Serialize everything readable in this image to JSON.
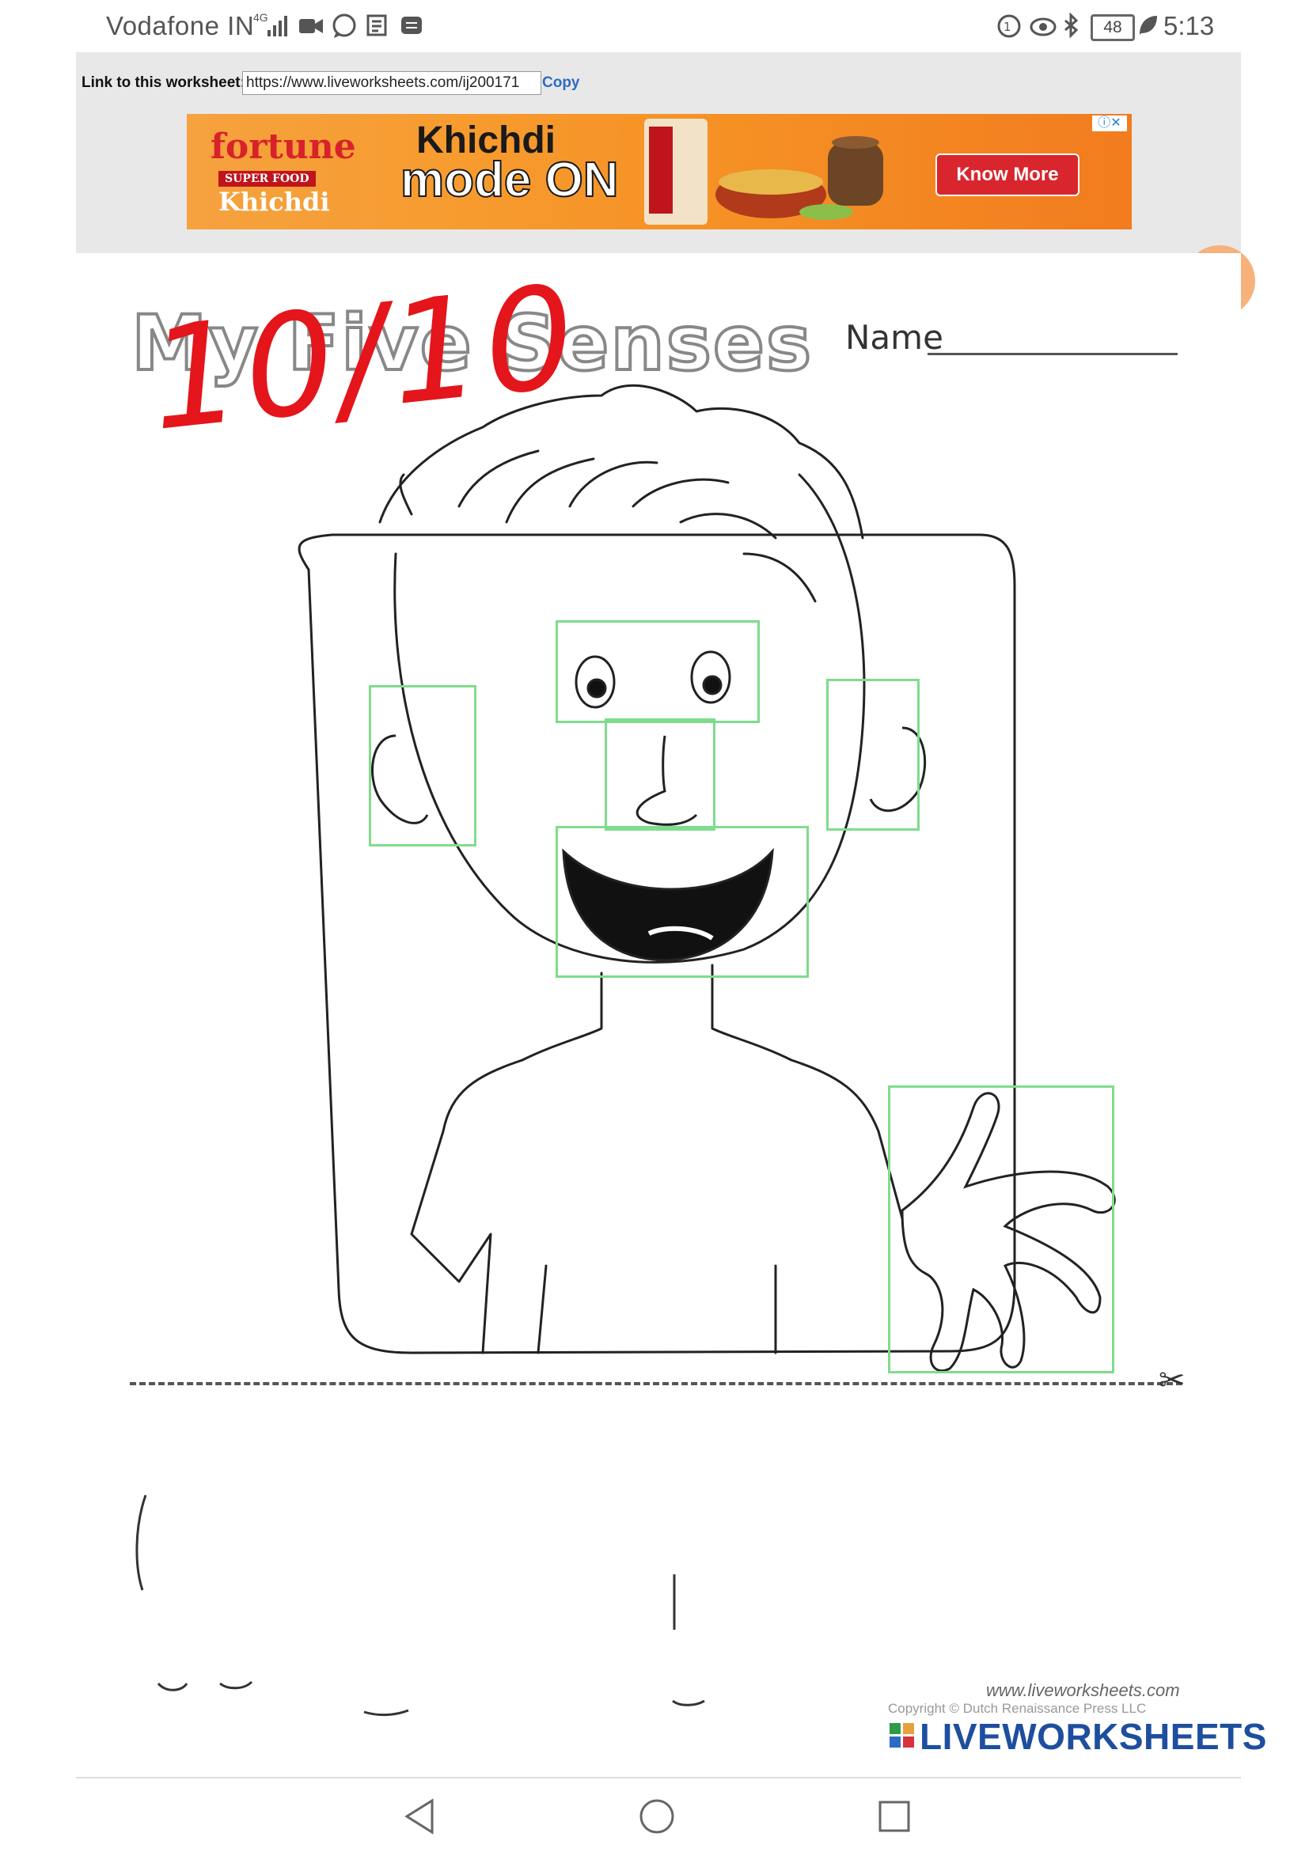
{
  "status_bar": {
    "carrier": "Vodafone IN",
    "network": "4G",
    "battery": "48",
    "time": "5:13"
  },
  "header": {
    "link_label": "Link to this worksheet:",
    "link_url": "https://www.liveworksheets.com/ij200171",
    "copy_label": "Copy"
  },
  "ad": {
    "brand": "fortune",
    "brand_sub": "SUPER FOOD",
    "brand_product": "Khichdi",
    "headline_line1": "Khichdi",
    "headline_line2": "mode ON",
    "cta": "Know More",
    "info": "ⓘ✕"
  },
  "worksheet": {
    "title": "My Five Senses",
    "name_label": "Name",
    "score": "10/10",
    "answer_boxes": [
      "eyes",
      "nose",
      "left-ear",
      "right-ear",
      "mouth",
      "hand"
    ]
  },
  "footer": {
    "site": "www.liveworksheets.com",
    "copyright": "Copyright © Dutch Renaissance Press LLC",
    "logo": "LIVEWORKSHEETS"
  },
  "colors": {
    "answer_box": "#7fdc8d",
    "score_red": "#e4151b",
    "ad_orange": "#f58f24",
    "cta_red": "#d9262e",
    "logo_blue": "#1e4e9e"
  },
  "icons": [
    "video-icon",
    "whatsapp-icon",
    "news-icon",
    "message-icon",
    "data-saver-icon",
    "eye-icon",
    "bluetooth-icon",
    "leaf-icon",
    "back-icon",
    "home-icon",
    "recents-icon",
    "record-icon",
    "scissors-icon"
  ]
}
